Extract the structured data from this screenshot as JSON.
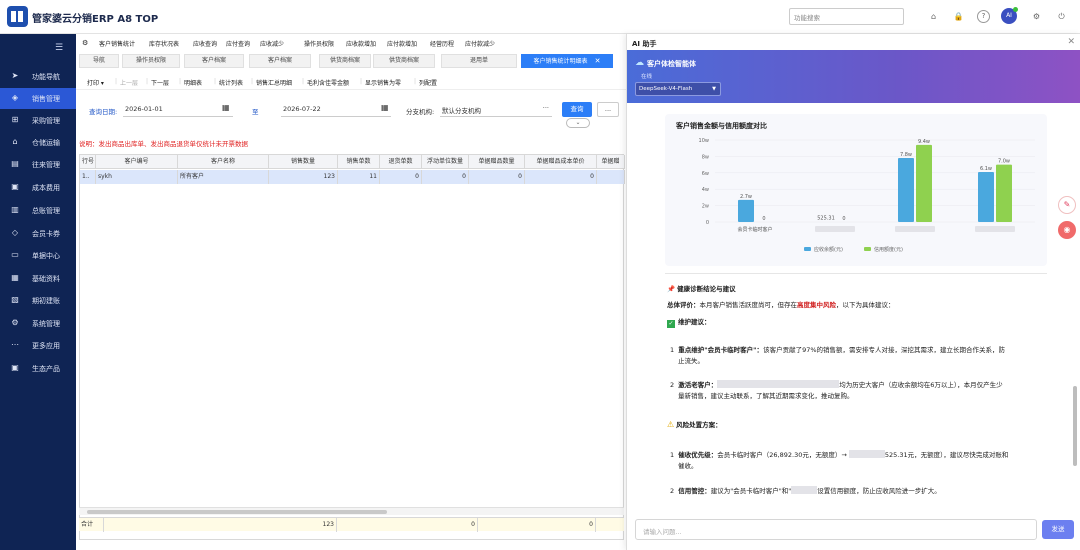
{
  "app": {
    "title": "管家婆云分销ERP A8 TOP",
    "search_placeholder": "功能搜索",
    "avatar": "AI"
  },
  "sidebar": {
    "items": [
      {
        "label": "功能导航",
        "icon": "send-icon"
      },
      {
        "label": "销售管理",
        "icon": "tag-icon"
      },
      {
        "label": "采购管理",
        "icon": "cart-icon"
      },
      {
        "label": "仓储运输",
        "icon": "warehouse-icon"
      },
      {
        "label": "往来管理",
        "icon": "ledger-icon"
      },
      {
        "label": "成本费用",
        "icon": "cost-icon"
      },
      {
        "label": "总账管理",
        "icon": "book-icon"
      },
      {
        "label": "会员卡券",
        "icon": "diamond-icon"
      },
      {
        "label": "单据中心",
        "icon": "doc-icon"
      },
      {
        "label": "基础资料",
        "icon": "data-icon"
      },
      {
        "label": "期初建账",
        "icon": "init-icon"
      },
      {
        "label": "系统管理",
        "icon": "gear-icon"
      },
      {
        "label": "更多应用",
        "icon": "apps-icon"
      },
      {
        "label": "生态产品",
        "icon": "eco-icon"
      }
    ],
    "active_index": 1
  },
  "menubar": {
    "items": [
      "客户销售统计",
      "库存状况表",
      "应收查询",
      "应付查询",
      "应收减少",
      "操作员权限",
      "应收款增加",
      "应付款增加",
      "经营历程",
      "应付款减少"
    ]
  },
  "tabs": {
    "items": [
      "导航",
      "操作员权限",
      "客户档案",
      "客户档案",
      "供货商档案",
      "供货商档案",
      "退用单",
      "客户销售统计明细表"
    ],
    "active_index": 7
  },
  "toolbar": {
    "items": [
      "打印 ▾",
      "上一层",
      "下一层",
      "明细表",
      "统计列表",
      "销售汇总明细",
      "毛利含佳零金额",
      "显示销售为零",
      "列配置"
    ],
    "disabled": [
      1
    ]
  },
  "filter": {
    "date_label": "查询日期:",
    "date_from": "2026-01-01",
    "to_label": "至",
    "date_to": "2026-07-22",
    "branch_label": "分支机构:",
    "branch_value": "默认分支机构",
    "query_label": "查询",
    "more_label": "..."
  },
  "warning": "说明：发出商品出库单、发出商品退货单仅统计未开票数据",
  "table": {
    "columns": [
      "行号",
      "客户编号",
      "客户名称",
      "销售数量",
      "销售单数",
      "退货单数",
      "浮动单位数量",
      "单据赠品数量",
      "单据赠品成本单价",
      "单据赠"
    ],
    "rows": [
      [
        "1..",
        "sykh",
        "所有客户",
        "123",
        "11",
        "0",
        "0",
        "0",
        "0",
        ""
      ]
    ],
    "total": {
      "label": "合计",
      "qty": "123",
      "v1": "0",
      "v2": "0"
    }
  },
  "ai": {
    "panel_title": "AI 助手",
    "agent_name": "客户体检智能体",
    "status": "在线",
    "model": "DeepSeek-V4-Flash",
    "input_placeholder": "请输入问题...",
    "send_label": "发送",
    "report": {
      "section_title": "健康诊断结论与建议",
      "summary_label": "总体评价：",
      "summary_pre": "本月客户销售活跃度尚可，但存在",
      "summary_red": "高度集中风险",
      "summary_post": "，以下为具体建议：",
      "maintain_title": "维护建议：",
      "item1_title": "重点维护\"会员卡临时客户\"：",
      "item1_line1": "该客户贡献了97%的销售额，需安排专人对接，深挖其需求，建立长期合作关系，防",
      "item1_line2": "止流失。",
      "item2_title": "激活老客户：",
      "item2_line1": "均为历史大客户（应收余额均在6万以上），本月仅产生少",
      "item2_line2": "量新销售，建议主动联系，了解其近期需求变化，推动复购。",
      "risk_title": "风险处置方案：",
      "item3_title": "催收优先级：",
      "item3_pre": "会员卡临时客户（26,892.30元，无额度）→",
      "item3_mid": "525.31元，无额度），建议尽快完成对账和",
      "item3_line2": "催收。",
      "item4_title": "信用管控：",
      "item4_pre": "建议为\"会员卡临时客户\"和\"",
      "item4_post": "设置信用额度，防止应收风险进一步扩大。"
    }
  },
  "chart_data": {
    "type": "bar",
    "title": "客户销售金额与信用额度对比",
    "categories": [
      "会员卡临时客户",
      "",
      "",
      ""
    ],
    "series": [
      {
        "name": "应收余额(元)",
        "color": "#4aa8de",
        "values": [
          2.7,
          0.0525,
          7.8,
          6.1
        ],
        "labels": [
          "2.7w",
          "525.31",
          "7.8w",
          "6.1w"
        ]
      },
      {
        "name": "信用额度(元)",
        "color": "#8fd14f",
        "values": [
          0,
          0,
          9.4,
          7.0
        ],
        "labels": [
          "0",
          "0",
          "9.4w",
          "7.0w"
        ]
      }
    ],
    "y_ticks": [
      "0",
      "2w",
      "4w",
      "6w",
      "8w",
      "10w"
    ],
    "ylim": [
      0,
      10
    ],
    "legend": "bottom"
  }
}
